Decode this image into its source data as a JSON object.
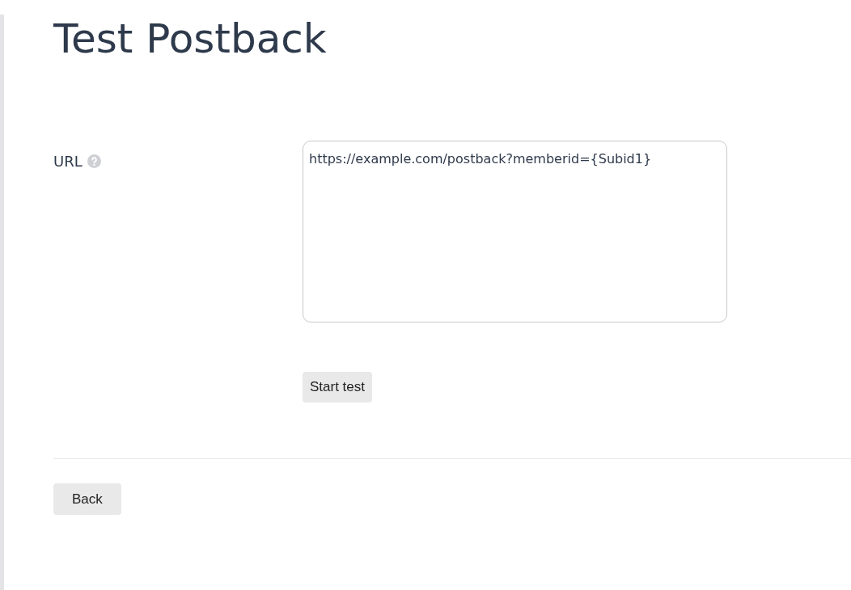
{
  "title": "Test Postback",
  "form": {
    "label": "URL",
    "url_value": "https://example.com/postback?memberid={Subid1}"
  },
  "buttons": [
    {
      "kind": "start",
      "label": "Start test"
    },
    {
      "kind": "back",
      "label": "Back"
    }
  ]
}
